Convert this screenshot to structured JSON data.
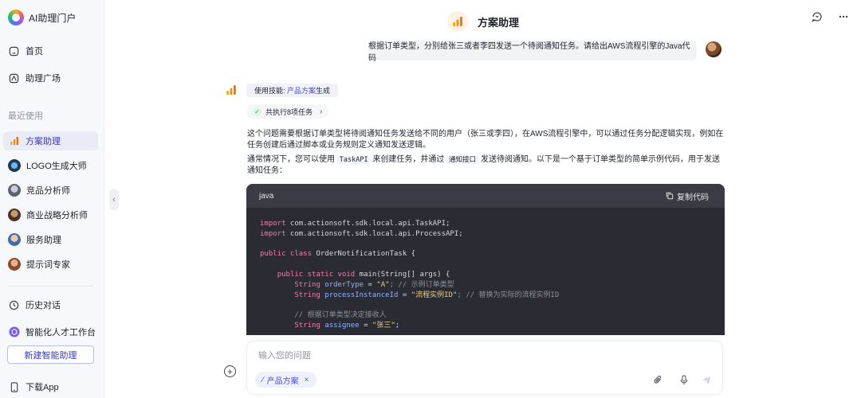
{
  "brand": {
    "name": "AI助理门户"
  },
  "nav": {
    "home": "首页",
    "plaza": "助理广场",
    "recent_label": "最近使用",
    "recent": [
      {
        "label": "方案助理",
        "active": true
      },
      {
        "label": "LOGO生成大师",
        "active": false
      },
      {
        "label": "竞品分析师",
        "active": false
      },
      {
        "label": "商业战略分析师",
        "active": false
      },
      {
        "label": "服务助理",
        "active": false
      },
      {
        "label": "提示词专家",
        "active": false
      }
    ],
    "history": "历史对话",
    "workbench": "智能化人才工作台",
    "new_button": "新建智能助理",
    "download": "下载App"
  },
  "header": {
    "title": "方案助理"
  },
  "user_message": "根据订单类型，分别给张三或者李四发送一个待阅通知任务。请给出AWS流程引擎的Java代码",
  "assistant": {
    "skill_prefix": "使用技能:",
    "skill_name": "产品方案",
    "skill_suffix": "生成",
    "tasks_summary": "共执行8项任务",
    "para1": "这个问题需要根据订单类型将待阅通知任务发送给不同的用户（张三或李四），在AWS流程引擎中，可以通过任务分配逻辑实现，例如在任务创建后通过脚本或业务规则定义通知发送逻辑。",
    "para2_a": "通常情况下，您可以使用",
    "para2_code1": "TaskAPI",
    "para2_b": "来创建任务，并通过",
    "para2_code2": "通知接口",
    "para2_c": "发送待阅通知。以下是一个基于订单类型的简单示例代码，用于发送通知任务：",
    "code": {
      "language": "java",
      "copy_label": "复制代码",
      "import1_kw": "import",
      "import1": " com.actionsoft.sdk.local.api.TaskAPI;",
      "import2_kw": "import",
      "import2": " com.actionsoft.sdk.local.api.ProcessAPI;",
      "class_kw": "public class",
      "class_name": " OrderNotificationTask",
      "class_open": " {",
      "main_kw": "public static void",
      "main_sig": " main(String[] args) {",
      "type1": "String",
      "var1": " orderType",
      "eq1": " = ",
      "str1": "\"A\"",
      "cm1": "; // 示例订单类型",
      "type2": "String",
      "var2": " processInstanceId",
      "eq2": " = ",
      "str2": "\"流程实例ID\"",
      "cm2": "; // 替换为实际的流程实例ID",
      "cm3": "// 根据订单类型决定接收人",
      "type3": "String",
      "var3": " assignee",
      "eq3": " = ",
      "str3": "\"张三\"",
      "end3": ";"
    }
  },
  "input": {
    "placeholder": "输入您的问题",
    "chip": "产品方案"
  },
  "colors": {
    "accent": "#4b4fd1",
    "active_bg": "#e9ebf7",
    "code_bg": "#2b2c33"
  }
}
